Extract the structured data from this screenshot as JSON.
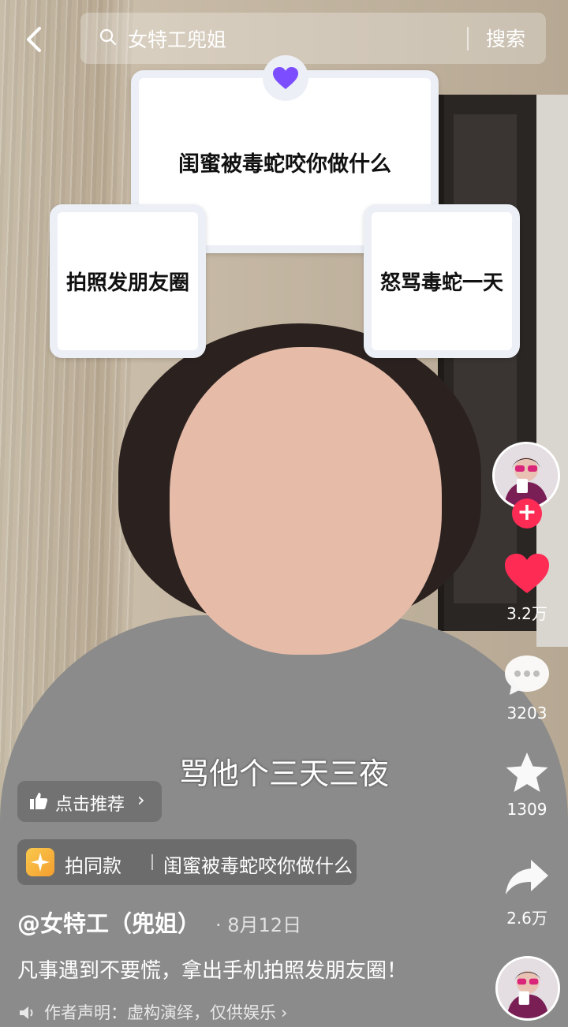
{
  "search": {
    "back_icon": "chevron-left-icon",
    "query": "女特工兜姐",
    "button_label": "搜索"
  },
  "overlay_cards": {
    "top": "闺蜜被毒蛇咬你做什么",
    "left": "拍照发朋友圈",
    "right": "怒骂毒蛇一天",
    "badge_icon": "heart-icon",
    "badge_color": "#7b4dff"
  },
  "video": {
    "subtitle": "骂他个三天三夜"
  },
  "recommend": {
    "label": "点击推荐",
    "icon": "thumbs-up-icon"
  },
  "template": {
    "label": "拍同款",
    "title": "闺蜜被毒蛇咬你做什么",
    "icon": "sparkle-icon"
  },
  "post": {
    "author": "@女特工（兜姐）",
    "date": "· 8月12日",
    "caption": "凡事遇到不要慌，拿出手机拍照发朋友圈！",
    "disclaimer": "作者声明：虚构演绎，仅供娱乐",
    "disclaimer_chevron": "›"
  },
  "actions": {
    "likes": "3.2万",
    "comments": "3203",
    "favorites": "1309",
    "shares": "2.6万",
    "like_color": "#fe2c55",
    "follow_color": "#fe2c55"
  }
}
